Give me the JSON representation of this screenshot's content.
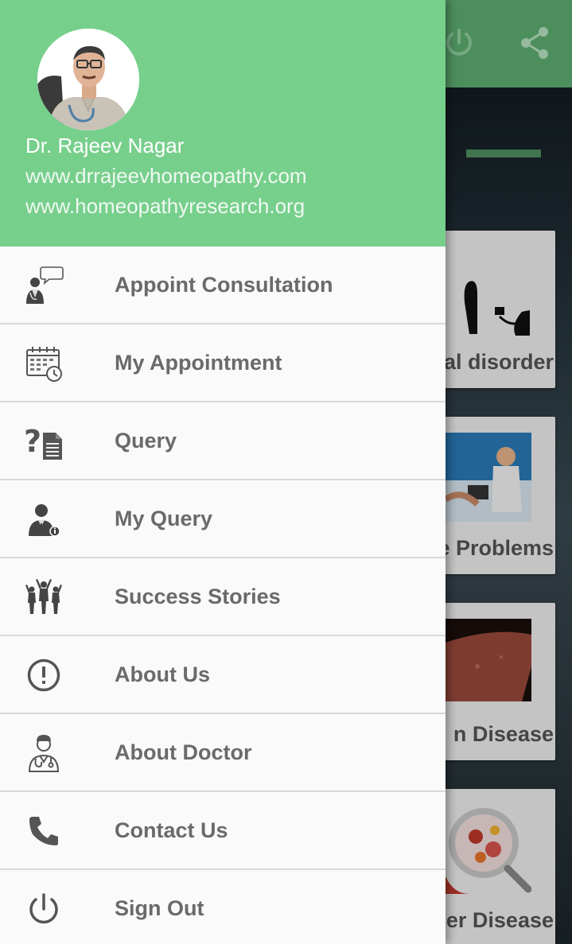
{
  "drawer": {
    "doctor_name": "Dr. Rajeev Nagar",
    "website_1": "www.drrajeevhomeopathy.com",
    "website_2": "www.homeopathyresearch.org",
    "header_color": "#77cf8c",
    "items": [
      {
        "label": "Appoint Consultation",
        "icon": "consultation-chat-icon"
      },
      {
        "label": "My Appointment",
        "icon": "calendar-clock-icon"
      },
      {
        "label": "Query",
        "icon": "question-document-icon"
      },
      {
        "label": "My Query",
        "icon": "user-info-icon"
      },
      {
        "label": "Success Stories",
        "icon": "celebrating-people-icon"
      },
      {
        "label": "About Us",
        "icon": "exclamation-circle-icon"
      },
      {
        "label": "About Doctor",
        "icon": "doctor-icon"
      },
      {
        "label": "Contact Us",
        "icon": "phone-icon"
      },
      {
        "label": "Sign Out",
        "icon": "power-icon"
      }
    ]
  },
  "background": {
    "toolbar_color": "#5fae72",
    "cards": [
      {
        "label": "al disorder"
      },
      {
        "label": "e Problems"
      },
      {
        "label": "n Disease"
      },
      {
        "label": "er Disease"
      }
    ]
  }
}
